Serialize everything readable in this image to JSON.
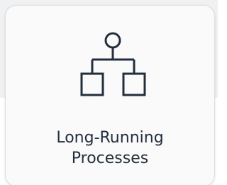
{
  "card": {
    "title_line1": "Long-Running",
    "title_line2": "Processes",
    "icon": "workflow-hierarchy-icon"
  },
  "colors": {
    "text": "#232f3e",
    "icon_stroke": "#232f3e",
    "card_bg": "#fafafa",
    "card_border": "#dcdfe2",
    "page_bg_top": "#f0f1f2"
  }
}
